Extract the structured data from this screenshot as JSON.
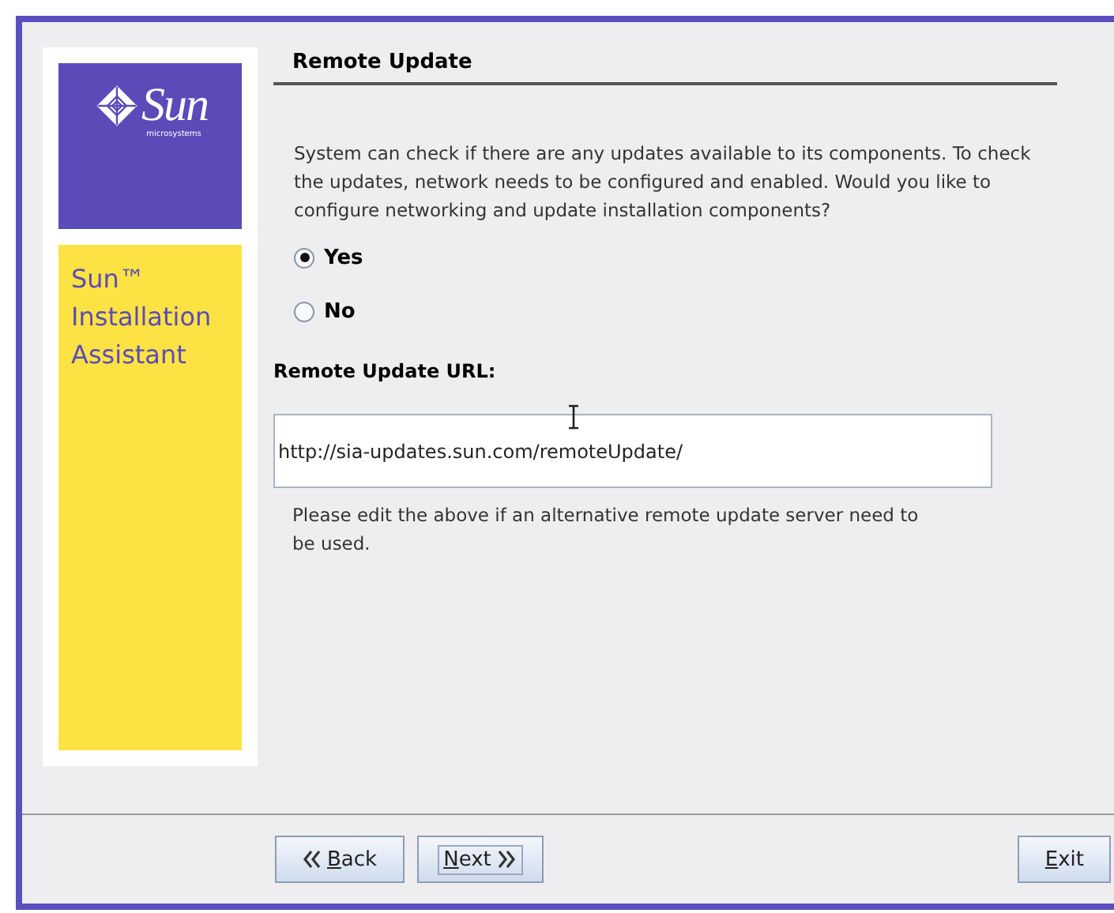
{
  "sidebar": {
    "logo": {
      "name": "Sun",
      "tagline": "microsystems"
    },
    "product": [
      "Sun™",
      "Installation",
      "Assistant"
    ]
  },
  "page": {
    "title": "Remote Update",
    "description": "System can check if there are any updates available to its components. To check the updates, network needs to be configured and enabled. Would you like to configure networking and update installation components?",
    "options": [
      {
        "label": "Yes",
        "selected": true
      },
      {
        "label": "No",
        "selected": false
      }
    ],
    "url_label": "Remote Update URL:",
    "url_value": "http://sia-updates.sun.com/remoteUpdate/",
    "help": "Please edit the above if an alternative remote update server need to be used."
  },
  "buttons": [
    {
      "label": "Back",
      "kind": "back",
      "focused": false
    },
    {
      "label": "Next",
      "kind": "next",
      "focused": true
    },
    {
      "label": "Exit",
      "kind": "exit",
      "focused": false
    }
  ]
}
